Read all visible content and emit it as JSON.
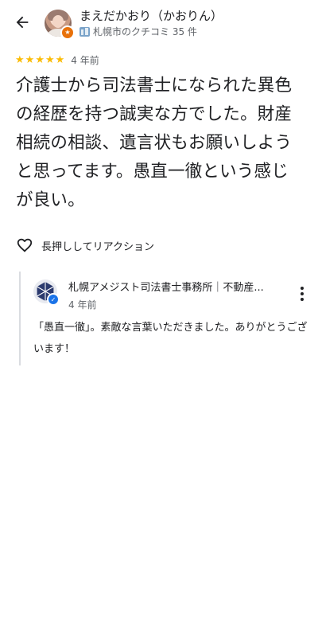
{
  "header": {
    "author_name": "まえだかおり（かおりん）",
    "author_meta": "札幌市のクチコミ 35 件"
  },
  "review": {
    "rating": 5,
    "max_rating": 5,
    "time": "4 年前",
    "text": "介護士から司法書士になられた異色の経歴を持つ誠実な方でした。財産相続の相談、遺言状もお願いしようと思ってます。愚直一徹という感じが良い。",
    "like_label": "長押ししてリアクション"
  },
  "owner_reply": {
    "name": "札幌アメジスト司法書士事務所｜不動産...",
    "time": "4 年前",
    "text": "「愚直一徹」。素敵な言葉いただきました。ありがとうございます！"
  },
  "colors": {
    "star": "#fbbc04",
    "local_guide_badge": "#e8710a",
    "verified_badge": "#1a73e8",
    "owner_logo": "#2b3a6e"
  },
  "icons": {
    "back": "arrow-left-icon",
    "like": "heart-outline-icon",
    "more": "more-vert-icon",
    "city": "city-icon"
  }
}
